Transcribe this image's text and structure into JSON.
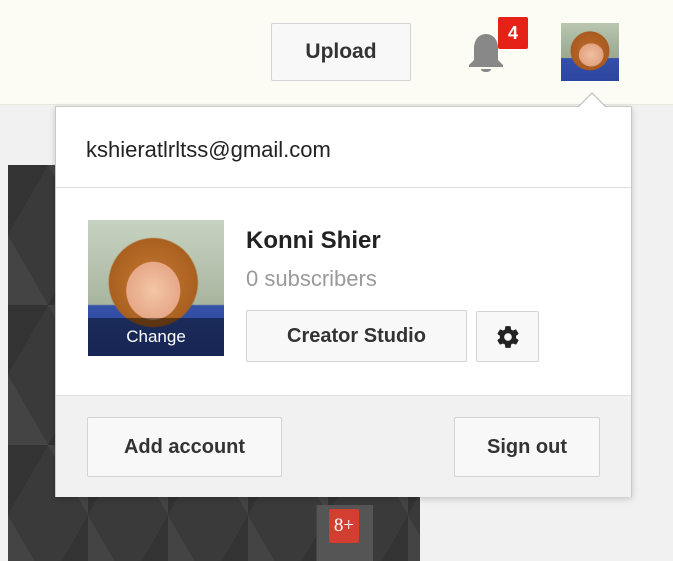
{
  "header": {
    "upload_label": "Upload",
    "notification_count": "4",
    "bell_icon": "bell-icon",
    "avatar_icon": "user-avatar"
  },
  "account_menu": {
    "email": "kshieratlrltss@gmail.com",
    "name": "Konni Shier",
    "subscribers": "0 subscribers",
    "change_label": "Change",
    "creator_studio_label": "Creator Studio",
    "settings_icon": "gear-icon",
    "add_account_label": "Add account",
    "sign_out_label": "Sign out"
  },
  "banner": {
    "gplus_label": "8+",
    "gplus_icon": "google-plus-icon"
  },
  "colors": {
    "notification_badge": "#e62117",
    "gplus_badge": "#d23f31",
    "button_bg": "#f8f8f8"
  }
}
